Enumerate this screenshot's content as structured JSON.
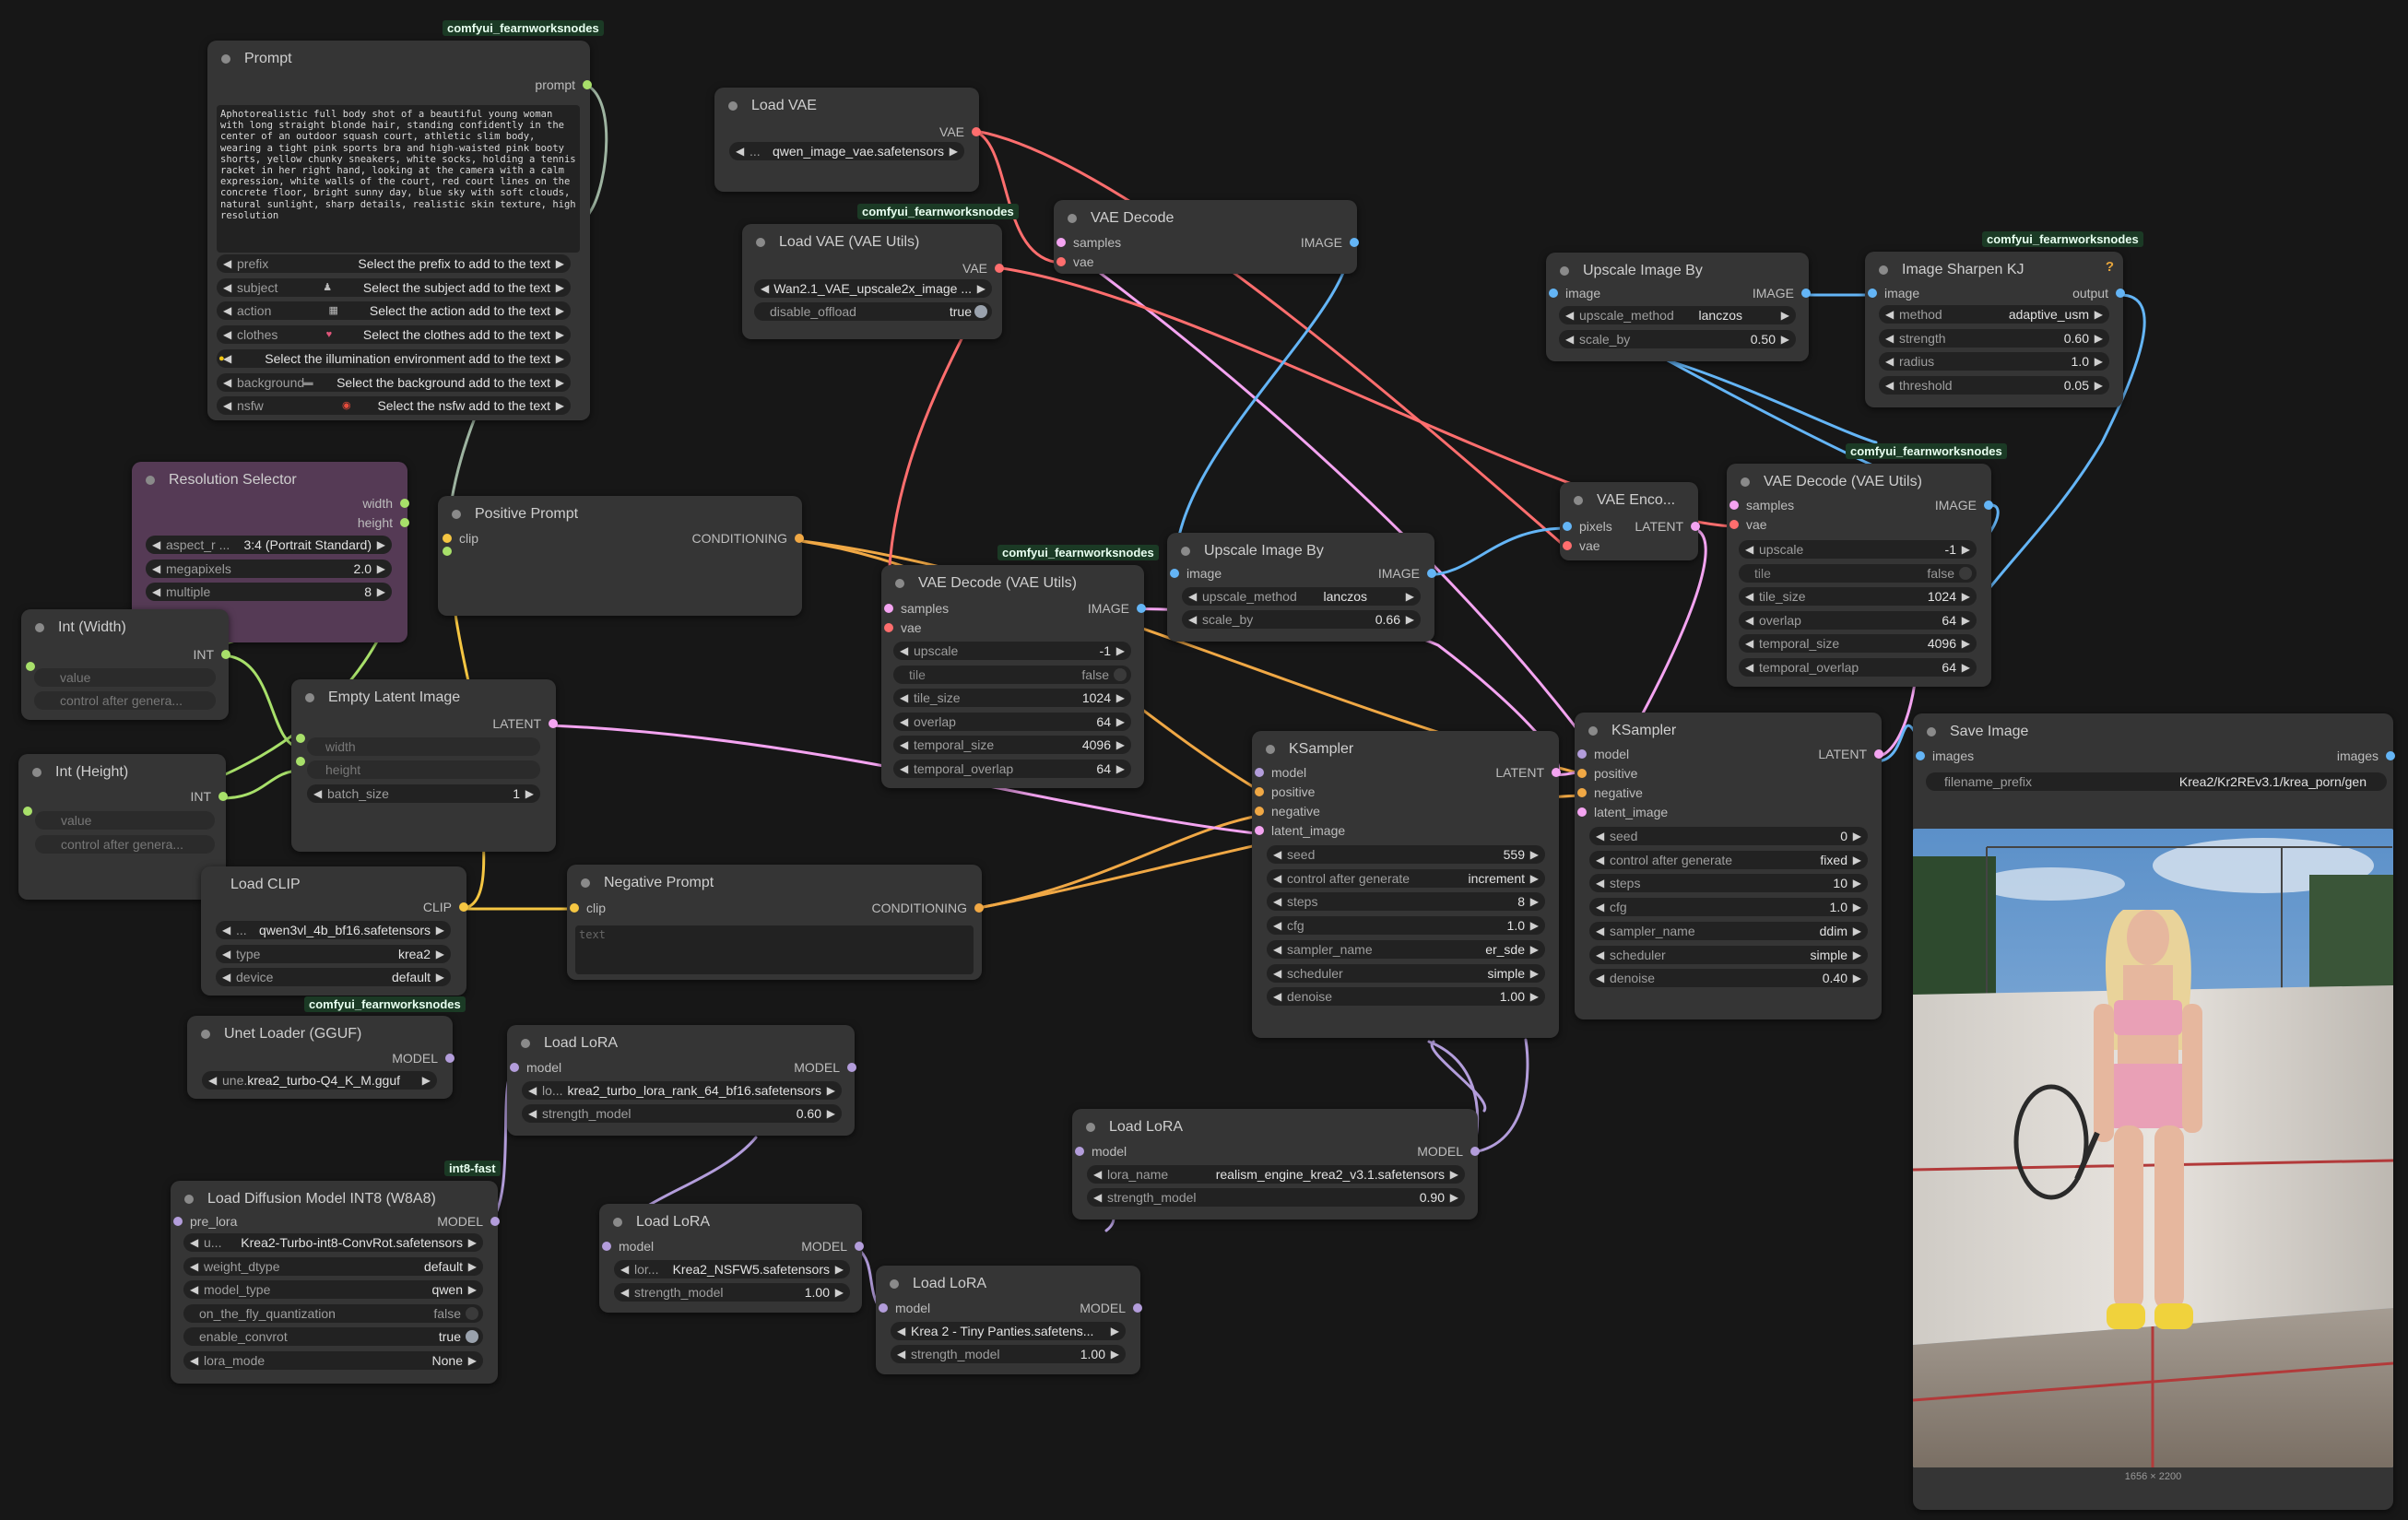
{
  "colors": {
    "canvas": "#171717",
    "node": "#353535",
    "clip": "#f5c642",
    "conditioning": "#f0a845",
    "latent": "#f4a4f1",
    "vae": "#ff6e6e",
    "image": "#64b5f6",
    "model": "#b39ddb",
    "int": "#a8e06a"
  },
  "nodes": {
    "prompt": {
      "title": "Prompt",
      "badge": "comfyui_fearnworksnodes",
      "out": "prompt",
      "text": "Aphotorealistic full body shot of a beautiful young woman with long straight blonde hair, standing confidently in the center of an outdoor squash court, athletic slim body, wearing a tight pink sports bra and high-waisted pink booty shorts, yellow chunky sneakers, white socks, holding a tennis racket in her right hand, looking at the camera with a calm expression, white walls of the court, red court lines on the concrete floor, bright sunny day, blue sky with soft clouds, natural sunlight, sharp details, realistic skin texture, high resolution",
      "widgets": [
        {
          "label": "prefix",
          "value": "Select the prefix to add to the text"
        },
        {
          "label": "subject",
          "value": "Select the subject add to the text",
          "icon": "person-icon"
        },
        {
          "label": "action",
          "value": "Select the action add to the text",
          "icon": "film-icon"
        },
        {
          "label": "clothes",
          "value": "Select the clothes add to the text",
          "icon": "dress-icon"
        },
        {
          "label": "",
          "value": "Select the illumination environment add to the text",
          "icon": "sun-icon"
        },
        {
          "label": "background",
          "value": "Select the background add to the text",
          "icon": "image-icon"
        },
        {
          "label": "nsfw",
          "value": "Select the nsfw add to the text",
          "icon": "warning-icon"
        }
      ]
    },
    "load_vae": {
      "title": "Load VAE",
      "out": "VAE",
      "widget": "qwen_image_vae.safetensors",
      "widget_prefix": "..."
    },
    "load_vae_utils": {
      "title": "Load VAE (VAE Utils)",
      "badge": "comfyui_fearnworksnodes",
      "out": "VAE",
      "widget": "Wan2.1_VAE_upscale2x_image ...",
      "toggle_label": "disable_offload",
      "toggle_value": "true"
    },
    "vae_decode": {
      "title": "VAE Decode",
      "in": [
        "samples",
        "vae"
      ],
      "out": "IMAGE"
    },
    "upscale1": {
      "title": "Upscale Image By",
      "in": "image",
      "out": "IMAGE",
      "widgets": [
        {
          "label": "upscale_method",
          "value": "lanczos"
        },
        {
          "label": "scale_by",
          "value": "0.50"
        }
      ]
    },
    "sharpen": {
      "title": "Image Sharpen KJ",
      "badge": "comfyui_fearnworksnodes",
      "in": "image",
      "out": "output",
      "help": "?",
      "widgets": [
        {
          "label": "method",
          "value": "adaptive_usm"
        },
        {
          "label": "strength",
          "value": "0.60"
        },
        {
          "label": "radius",
          "value": "1.0"
        },
        {
          "label": "threshold",
          "value": "0.05"
        }
      ]
    },
    "resolution": {
      "title": "Resolution Selector",
      "out": [
        "width",
        "height"
      ],
      "widgets": [
        {
          "label": "aspect_r ...",
          "value": "3:4 (Portrait Standard)"
        },
        {
          "label": "megapixels",
          "value": "2.0"
        },
        {
          "label": "multiple",
          "value": "8"
        }
      ]
    },
    "positive": {
      "title": "Positive Prompt",
      "in": "clip",
      "out": "CONDITIONING"
    },
    "int_width": {
      "title": "Int (Width)",
      "out": "INT",
      "widgets": [
        "value",
        "control after genera..."
      ]
    },
    "int_height": {
      "title": "Int (Height)",
      "out": "INT",
      "widgets": [
        "value",
        "control after genera..."
      ]
    },
    "empty_latent": {
      "title": "Empty Latent Image",
      "out": "LATENT",
      "widgets": [
        {
          "label": "width",
          "value": ""
        },
        {
          "label": "height",
          "value": ""
        },
        {
          "label": "batch_size",
          "value": "1"
        }
      ]
    },
    "vae_decode_utils1": {
      "title": "VAE Decode (VAE Utils)",
      "badge": "comfyui_fearnworksnodes",
      "in": [
        "samples",
        "vae"
      ],
      "out": "IMAGE",
      "widgets": [
        {
          "label": "upscale",
          "value": "-1"
        },
        {
          "label": "tile",
          "value": "false"
        },
        {
          "label": "tile_size",
          "value": "1024"
        },
        {
          "label": "overlap",
          "value": "64"
        },
        {
          "label": "temporal_size",
          "value": "4096"
        },
        {
          "label": "temporal_overlap",
          "value": "64"
        }
      ]
    },
    "upscale2": {
      "title": "Upscale Image By",
      "in": "image",
      "out": "IMAGE",
      "widgets": [
        {
          "label": "upscale_method",
          "value": "lanczos"
        },
        {
          "label": "scale_by",
          "value": "0.66"
        }
      ]
    },
    "vae_encode": {
      "title": "VAE Enco...",
      "in": [
        "pixels",
        "vae"
      ],
      "out": "LATENT"
    },
    "vae_decode_utils2": {
      "title": "VAE Decode (VAE Utils)",
      "badge": "comfyui_fearnworksnodes",
      "in": [
        "samples",
        "vae"
      ],
      "out": "IMAGE",
      "widgets": [
        {
          "label": "upscale",
          "value": "-1"
        },
        {
          "label": "tile",
          "value": "false"
        },
        {
          "label": "tile_size",
          "value": "1024"
        },
        {
          "label": "overlap",
          "value": "64"
        },
        {
          "label": "temporal_size",
          "value": "4096"
        },
        {
          "label": "temporal_overlap",
          "value": "64"
        }
      ]
    },
    "ksampler1": {
      "title": "KSampler",
      "in": [
        "model",
        "positive",
        "negative",
        "latent_image"
      ],
      "out": "LATENT",
      "widgets": [
        {
          "label": "seed",
          "value": "559"
        },
        {
          "label": "control after generate",
          "value": "increment"
        },
        {
          "label": "steps",
          "value": "8"
        },
        {
          "label": "cfg",
          "value": "1.0"
        },
        {
          "label": "sampler_name",
          "value": "er_sde"
        },
        {
          "label": "scheduler",
          "value": "simple"
        },
        {
          "label": "denoise",
          "value": "1.00"
        }
      ]
    },
    "ksampler2": {
      "title": "KSampler",
      "in": [
        "model",
        "positive",
        "negative",
        "latent_image"
      ],
      "out": "LATENT",
      "widgets": [
        {
          "label": "seed",
          "value": "0"
        },
        {
          "label": "control after generate",
          "value": "fixed"
        },
        {
          "label": "steps",
          "value": "10"
        },
        {
          "label": "cfg",
          "value": "1.0"
        },
        {
          "label": "sampler_name",
          "value": "ddim"
        },
        {
          "label": "scheduler",
          "value": "simple"
        },
        {
          "label": "denoise",
          "value": "0.40"
        }
      ]
    },
    "save_image": {
      "title": "Save Image",
      "in": "images",
      "out": "images",
      "label": "filename_prefix",
      "value": "Krea2/Kr2REv3.1/krea_porn/gen",
      "caption": "1656 × 2200"
    },
    "load_clip": {
      "title": "Load CLIP",
      "out": "CLIP",
      "widgets": [
        {
          "label": "...",
          "value": "qwen3vl_4b_bf16.safetensors"
        },
        {
          "label": "type",
          "value": "krea2"
        },
        {
          "label": "device",
          "value": "default"
        }
      ]
    },
    "negative": {
      "title": "Negative Prompt",
      "in": "clip",
      "out": "CONDITIONING",
      "placeholder": "text"
    },
    "unet": {
      "title": "Unet Loader (GGUF)",
      "badge": "comfyui_fearnworksnodes",
      "out": "MODEL",
      "widget_label": "une...",
      "widget_value": "krea2_turbo-Q4_K_M.gguf"
    },
    "lora1": {
      "title": "Load LoRA",
      "in": "model",
      "out": "MODEL",
      "widgets": [
        {
          "label": "lo...",
          "value": "krea2_turbo_lora_rank_64_bf16.safetensors"
        },
        {
          "label": "strength_model",
          "value": "0.60"
        }
      ]
    },
    "lora2": {
      "title": "Load LoRA",
      "in": "model",
      "out": "MODEL",
      "widgets": [
        {
          "label": "lora_name",
          "value": "realism_engine_krea2_v3.1.safetensors"
        },
        {
          "label": "strength_model",
          "value": "0.90"
        }
      ]
    },
    "lora3": {
      "title": "Load LoRA",
      "in": "model",
      "out": "MODEL",
      "widgets": [
        {
          "label": "lor...",
          "value": "Krea2_NSFW5.safetensors"
        },
        {
          "label": "strength_model",
          "value": "1.00"
        }
      ]
    },
    "lora4": {
      "title": "Load LoRA",
      "in": "model",
      "out": "MODEL",
      "widgets": [
        {
          "label": "",
          "value": "Krea 2 - Tiny Panties.safetens..."
        },
        {
          "label": "strength_model",
          "value": "1.00"
        }
      ]
    },
    "int8": {
      "title": "Load Diffusion Model INT8 (W8A8)",
      "badge": "int8-fast",
      "in": "pre_lora",
      "out": "MODEL",
      "widgets": [
        {
          "label": "u...",
          "value": "Krea2-Turbo-int8-ConvRot.safetensors"
        },
        {
          "label": "weight_dtype",
          "value": "default"
        },
        {
          "label": "model_type",
          "value": "qwen"
        },
        {
          "label": "on_the_fly_quantization",
          "value": "false"
        },
        {
          "label": "enable_convrot",
          "value": "true"
        },
        {
          "label": "lora_mode",
          "value": "None"
        }
      ]
    }
  }
}
